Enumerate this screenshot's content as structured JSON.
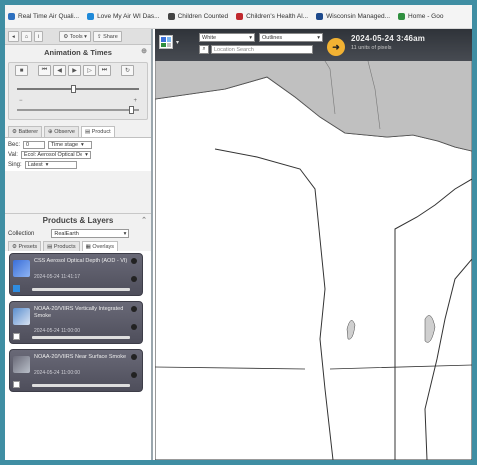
{
  "bookmarks": [
    {
      "label": "Real Time Air Quali...",
      "color": "#2c6fbf"
    },
    {
      "label": "Love My Air WI Das...",
      "color": "#1f8ad9"
    },
    {
      "label": "Children Counted",
      "color": "#444"
    },
    {
      "label": "Children's Health Al...",
      "color": "#c0282d"
    },
    {
      "label": "Wisconsin Managed...",
      "color": "#1e4a8c"
    },
    {
      "label": "Home - Goo",
      "color": "#2f8f3f"
    }
  ],
  "left_panel": {
    "toolbar": {
      "tools_label": "Tools",
      "share_label": "Share"
    },
    "animation": {
      "title": "Animation & Times"
    },
    "tabs": [
      "Batterer",
      "Observe",
      "Product"
    ],
    "fields": {
      "row1_label": "Bec:",
      "row1_value": "0",
      "row1_select": "Time stage",
      "row2_label": "Val:",
      "row2_value": "Ecol: Aerosol Optical Depth",
      "row3_label": "Sing:",
      "row3_value": "Latest"
    },
    "products_title": "Products & Layers",
    "collection": {
      "label": "Collection",
      "value": "RealEarth"
    },
    "subtabs": [
      "Presets",
      "Products",
      "Overlays"
    ],
    "layers": [
      {
        "title": "CSS Aerosol Optical Depth (AOD - VI)",
        "time": "2024-05-24 11:41:17"
      },
      {
        "title": "NOAA-20/VIIRS Vertically Integrated Smoke",
        "time": "2024-05-24 11:00:00"
      },
      {
        "title": "NOAA-20/VIIRS Near Surface Smoke",
        "time": "2024-05-24 11:00:00"
      }
    ]
  },
  "map": {
    "basemap_select": "White",
    "outline_select": "Outlines",
    "search_placeholder": "Location Search",
    "datetime": "2024-05-24 3:46am",
    "datetime_sub": "11 units of pixels",
    "colors": {
      "land": "#ffffff",
      "canada": "#c2c2c2",
      "water": "#f6f6f6",
      "border": "#444444",
      "toolbar": "#3a3e44",
      "accent": "#f2b233"
    }
  }
}
